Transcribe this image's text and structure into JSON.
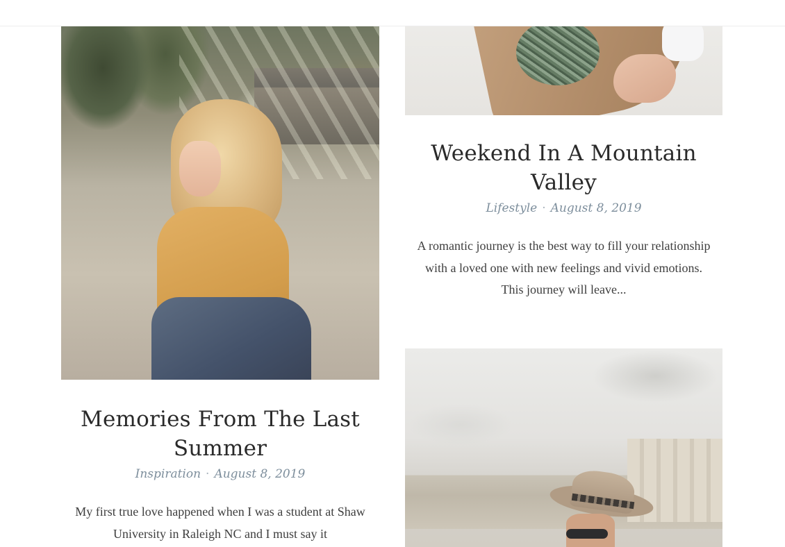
{
  "posts": [
    {
      "title": "Memories From The Last Summer",
      "category": "Inspiration",
      "separator": "·",
      "date": "August 8, 2019",
      "excerpt": "My first true love happened when I was a student at Shaw University in Raleigh NC and I must say it",
      "image_icon": "woman-on-path-photo"
    },
    {
      "title": "Weekend In A Mountain Valley",
      "category": "Lifestyle",
      "separator": "·",
      "date": "August 8, 2019",
      "excerpt": "A romantic journey is the best way to fill your relationship with a loved one with new feelings and vivid emotions. This journey will leave...",
      "image_icon": "flower-bouquet-photo"
    },
    {
      "image_icon": "man-with-hat-photo"
    }
  ],
  "colors": {
    "title": "#2a2a2a",
    "meta": "#7d8e9c",
    "text": "#3e3e3e",
    "background": "#ffffff"
  }
}
